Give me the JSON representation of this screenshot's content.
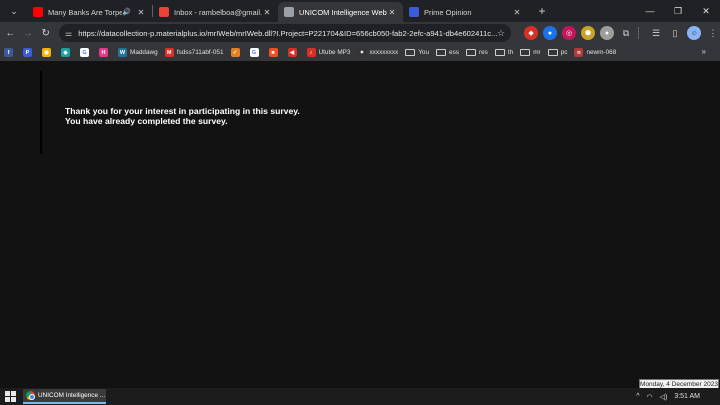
{
  "tabs": [
    {
      "title": "Many Banks Are Torpedoing",
      "favicon": "youtube-icon",
      "color": "#ff0000",
      "audio": true,
      "active": false
    },
    {
      "title": "Inbox - rambelboa@gmail.com",
      "favicon": "gmail-icon",
      "color": "#ea4335",
      "audio": false,
      "active": false
    },
    {
      "title": "UNICOM Intelligence Web Inte",
      "favicon": "globe-icon",
      "color": "#9aa0a6",
      "audio": false,
      "active": true
    },
    {
      "title": "Prime Opinion",
      "favicon": "prime-opinion-icon",
      "color": "#3b5bdb",
      "audio": false,
      "active": false
    }
  ],
  "toolbar": {
    "url": "https://datacollection-p.materialplus.io/mrIWeb/mrIWeb.dll?I.Project=P221704&ID=656cb050-fab2-2efc-a941-db4e602411c..."
  },
  "bookmarks": [
    {
      "label": "",
      "icon": "facebook-icon",
      "color": "#3b5998",
      "glyph": "f"
    },
    {
      "label": "",
      "icon": "prime-opinion-icon",
      "color": "#3b5bdb",
      "glyph": "P"
    },
    {
      "label": "",
      "icon": "location-pin-icon",
      "color": "#f2b400",
      "glyph": "◉"
    },
    {
      "label": "",
      "icon": "teal-drop-icon",
      "color": "#1aa3a3",
      "glyph": "◆"
    },
    {
      "label": "",
      "icon": "google-icon",
      "color": "#ffffff",
      "glyph": "G"
    },
    {
      "label": "",
      "icon": "h-icon",
      "color": "#e5398a",
      "glyph": "H"
    },
    {
      "label": "Maddawg",
      "icon": "wordpress-icon",
      "color": "#21759b",
      "glyph": "W"
    },
    {
      "label": "fsdss711abf-051",
      "icon": "app-red-icon",
      "color": "#d93025",
      "glyph": "M"
    },
    {
      "label": "",
      "icon": "orange-check-icon",
      "color": "#e67e22",
      "glyph": "✓"
    },
    {
      "label": "",
      "icon": "google-icon",
      "color": "#ffffff",
      "glyph": "G"
    },
    {
      "label": "",
      "icon": "microsoft-icon",
      "color": "#f25022",
      "glyph": "■"
    },
    {
      "label": "",
      "icon": "red-tag-icon",
      "color": "#d93025",
      "glyph": "◀"
    },
    {
      "label": "Utube MP3",
      "icon": "utube-mp3-icon",
      "color": "#d93025",
      "glyph": "♪"
    },
    {
      "label": "xxxxxxxxx",
      "icon": "dark-icon",
      "color": "#333333",
      "glyph": "✦"
    },
    {
      "label": "You",
      "icon": "folder-icon",
      "folder": true
    },
    {
      "label": "ess",
      "icon": "folder-icon",
      "folder": true
    },
    {
      "label": "res",
      "icon": "folder-icon",
      "folder": true
    },
    {
      "label": "th",
      "icon": "folder-icon",
      "folder": true
    },
    {
      "label": "mr",
      "icon": "folder-icon",
      "folder": true
    },
    {
      "label": "pc",
      "icon": "folder-icon",
      "folder": true
    },
    {
      "label": "newm-068",
      "icon": "newm-icon",
      "color": "#b33a3a",
      "glyph": "n"
    }
  ],
  "page": {
    "line1": "Thank you for your interest in participating in this survey.",
    "line2": "You have already completed the survey."
  },
  "taskbar": {
    "app_label": "UNICOM Intelligence ...",
    "time": "3:51 AM",
    "date_tooltip": "Monday, 4 December 2023"
  }
}
